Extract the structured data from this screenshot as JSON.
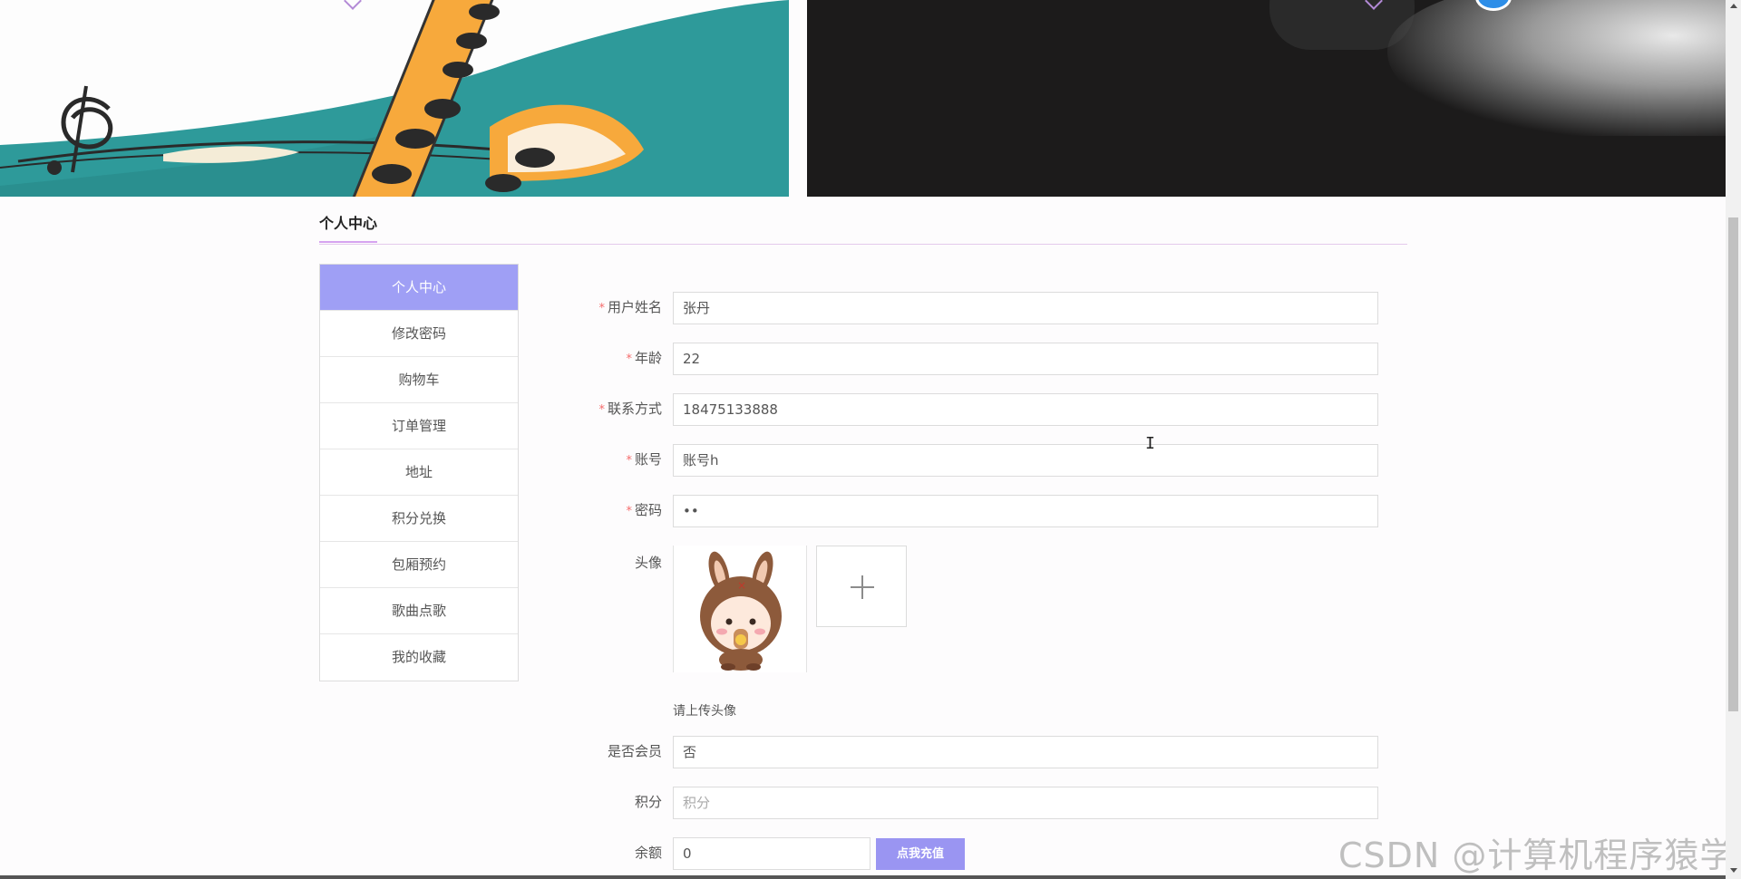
{
  "section": {
    "title": "个人中心"
  },
  "sidebar": {
    "items": [
      {
        "label": "个人中心",
        "active": true
      },
      {
        "label": "修改密码"
      },
      {
        "label": "购物车"
      },
      {
        "label": "订单管理"
      },
      {
        "label": "地址"
      },
      {
        "label": "积分兑换"
      },
      {
        "label": "包厢预约"
      },
      {
        "label": "歌曲点歌"
      },
      {
        "label": "我的收藏"
      }
    ]
  },
  "form": {
    "username": {
      "label": "用户姓名",
      "value": "张丹",
      "required": true
    },
    "age": {
      "label": "年龄",
      "value": "22",
      "required": true
    },
    "phone": {
      "label": "联系方式",
      "value": "18475133888",
      "required": true
    },
    "account": {
      "label": "账号",
      "value": "账号h",
      "required": true
    },
    "password": {
      "label": "密码",
      "value": "••",
      "required": true
    },
    "avatar": {
      "label": "头像",
      "hint": "请上传头像"
    },
    "is_member": {
      "label": "是否会员",
      "value": "否"
    },
    "points": {
      "label": "积分",
      "placeholder": "积分"
    },
    "balance": {
      "label": "余额",
      "value": "0",
      "recharge_label": "点我充值"
    },
    "required_mark": "*"
  },
  "watermark": "CSDN @计算机程序猿学长",
  "colors": {
    "accent": "#9f9ff5",
    "button": "#9a95f2",
    "required": "#f56c6c"
  }
}
